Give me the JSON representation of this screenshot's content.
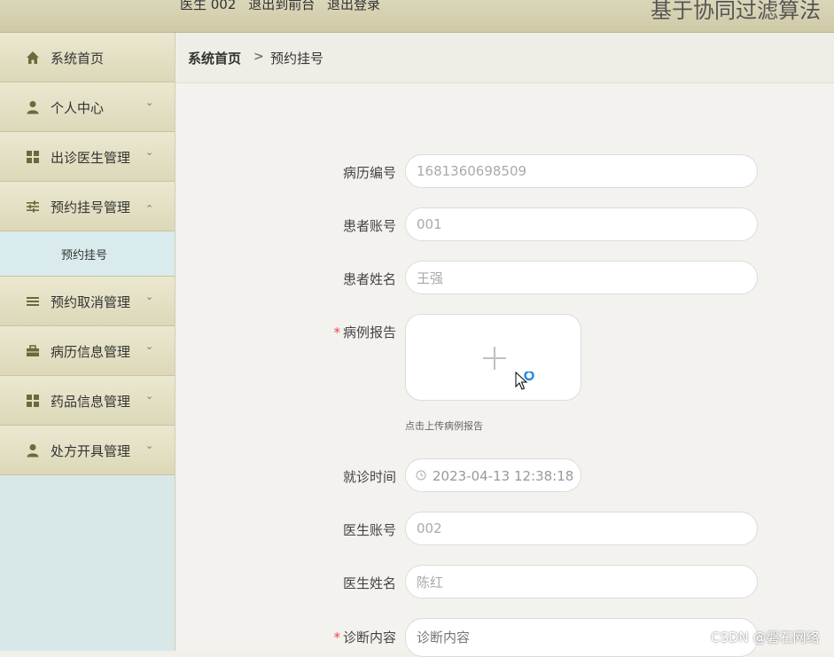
{
  "header": {
    "user_label": "医生 002",
    "back_label": "退出到前台",
    "logout_label": "退出登录",
    "site_title": "基于协同过滤算法"
  },
  "sidebar": {
    "items": [
      {
        "label": "系统首页",
        "icon": "home-icon"
      },
      {
        "label": "个人中心",
        "icon": "user-icon"
      },
      {
        "label": "出诊医生管理",
        "icon": "grid-icon"
      },
      {
        "label": "预约挂号管理",
        "icon": "sliders-icon"
      },
      {
        "label": "预约取消管理",
        "icon": "list-icon"
      },
      {
        "label": "病历信息管理",
        "icon": "briefcase-icon"
      },
      {
        "label": "药品信息管理",
        "icon": "grid-icon"
      },
      {
        "label": "处方开具管理",
        "icon": "user-icon"
      }
    ],
    "submenu": {
      "label": "预约挂号"
    }
  },
  "breadcrumb": {
    "home": "系统首页",
    "separator": ">",
    "current": "预约挂号"
  },
  "form": {
    "record_no": {
      "label": "病历编号",
      "value": "1681360698509"
    },
    "patient_account": {
      "label": "患者账号",
      "value": "001"
    },
    "patient_name": {
      "label": "患者姓名",
      "value": "王强"
    },
    "case_report": {
      "label": "病例报告",
      "hint": "点击上传病例报告"
    },
    "visit_time": {
      "label": "就诊时间",
      "value": "2023-04-13 12:38:18"
    },
    "doctor_account": {
      "label": "医生账号",
      "value": "002"
    },
    "doctor_name": {
      "label": "医生姓名",
      "value": "陈红"
    },
    "diagnosis": {
      "label": "诊断内容",
      "placeholder": "诊断内容"
    }
  },
  "watermark": "CSDN @磐石网络",
  "colors": {
    "accent_icon": "#6b6a3a",
    "required": "#e64a4a",
    "sidebar_bg": "#d8e8e9"
  }
}
